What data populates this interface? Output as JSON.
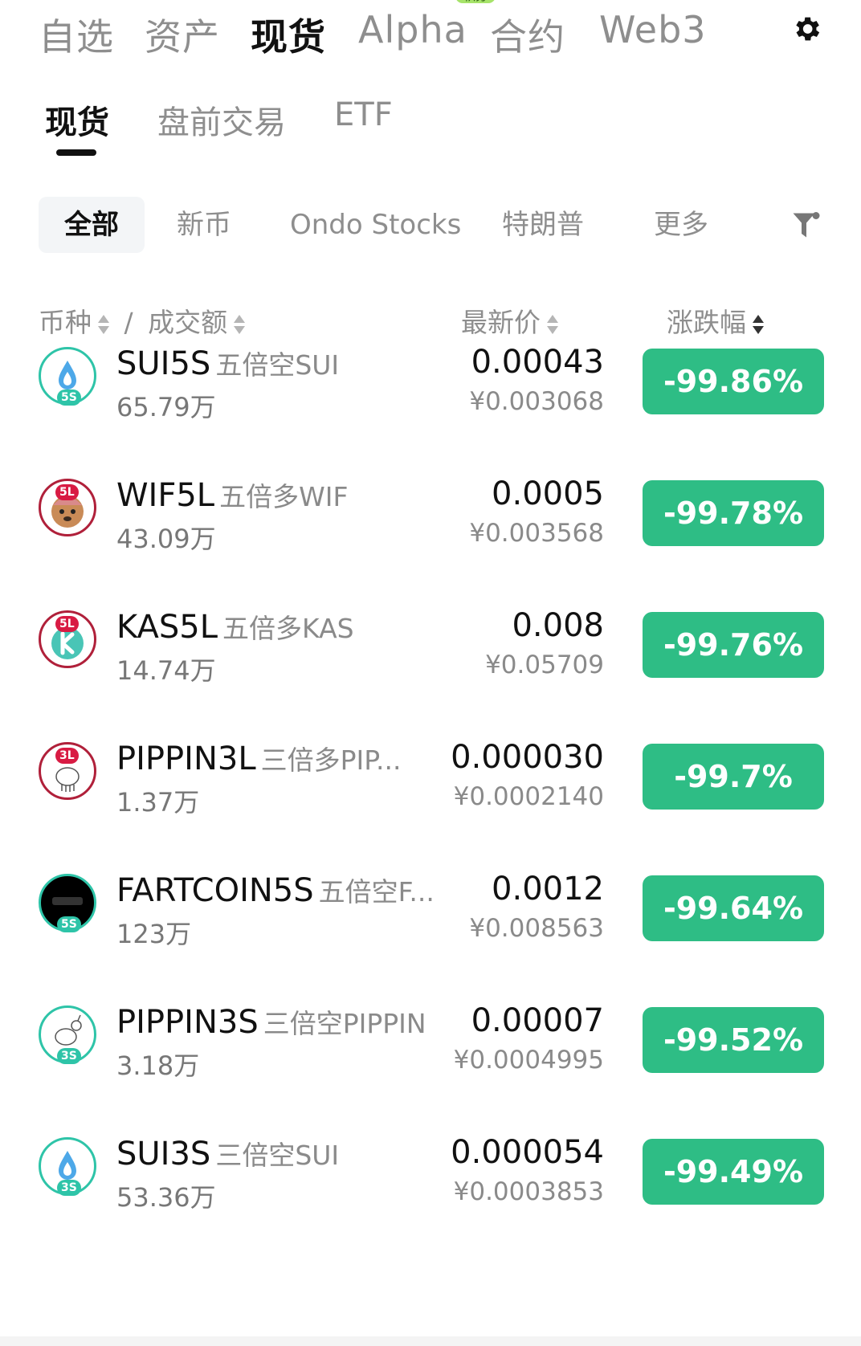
{
  "top_tabs": [
    {
      "label": "自选",
      "active": false
    },
    {
      "label": "资产",
      "active": false
    },
    {
      "label": "现货",
      "active": true
    },
    {
      "label": "Alpha",
      "active": false,
      "badge": "积分"
    },
    {
      "label": "合约",
      "active": false
    },
    {
      "label": "Web3",
      "active": false
    }
  ],
  "sub_tabs": [
    {
      "label": "现货",
      "active": true
    },
    {
      "label": "盘前交易",
      "active": false
    },
    {
      "label": "ETF",
      "active": false
    }
  ],
  "chips": [
    {
      "label": "全部",
      "active": true
    },
    {
      "label": "新币",
      "active": false
    },
    {
      "label": "Ondo Stocks",
      "active": false
    },
    {
      "label": "特朗普",
      "active": false
    },
    {
      "label": "更多",
      "active": false
    }
  ],
  "columns": {
    "coin": "币种",
    "separator": "/",
    "volume": "成交额",
    "price": "最新价",
    "change": "涨跌幅"
  },
  "rows": [
    {
      "symbol": "SUI5S",
      "desc": "五倍空SUI",
      "volume": "65.79万",
      "price": "0.00043",
      "cny": "¥0.003068",
      "change": "-99.86%",
      "icon": "sui-drop-icon",
      "leverage": "5S"
    },
    {
      "symbol": "WIF5L",
      "desc": "五倍多WIF",
      "volume": "43.09万",
      "price": "0.0005",
      "cny": "¥0.003568",
      "change": "-99.78%",
      "icon": "dog-hat-icon",
      "leverage": "5L"
    },
    {
      "symbol": "KAS5L",
      "desc": "五倍多KAS",
      "volume": "14.74万",
      "price": "0.008",
      "cny": "¥0.05709",
      "change": "-99.76%",
      "icon": "kaspa-icon",
      "leverage": "5L"
    },
    {
      "symbol": "PIPPIN3L",
      "desc": "三倍多PIP...",
      "volume": "1.37万",
      "price": "0.000030",
      "cny": "¥0.0002140",
      "change": "-99.7%",
      "icon": "pippin-unicorn-icon",
      "leverage": "3L"
    },
    {
      "symbol": "FARTCOIN5S",
      "desc": "五倍空F...",
      "volume": "123万",
      "price": "0.0012",
      "cny": "¥0.008563",
      "change": "-99.64%",
      "icon": "fartcoin-icon",
      "leverage": "5S"
    },
    {
      "symbol": "PIPPIN3S",
      "desc": "三倍空PIPPIN",
      "volume": "3.18万",
      "price": "0.00007",
      "cny": "¥0.0004995",
      "change": "-99.52%",
      "icon": "pippin-unicorn-icon",
      "leverage": "3S"
    },
    {
      "symbol": "SUI3S",
      "desc": "三倍空SUI",
      "volume": "53.36万",
      "price": "0.000054",
      "cny": "¥0.0003853",
      "change": "-99.49%",
      "icon": "sui-drop-icon",
      "leverage": "3S"
    }
  ],
  "colors": {
    "positive_bg": "#2ebd85",
    "accent_badge": "#a6e36a",
    "short_badge": "#2ec4a8",
    "long_badge": "#d81b43"
  }
}
